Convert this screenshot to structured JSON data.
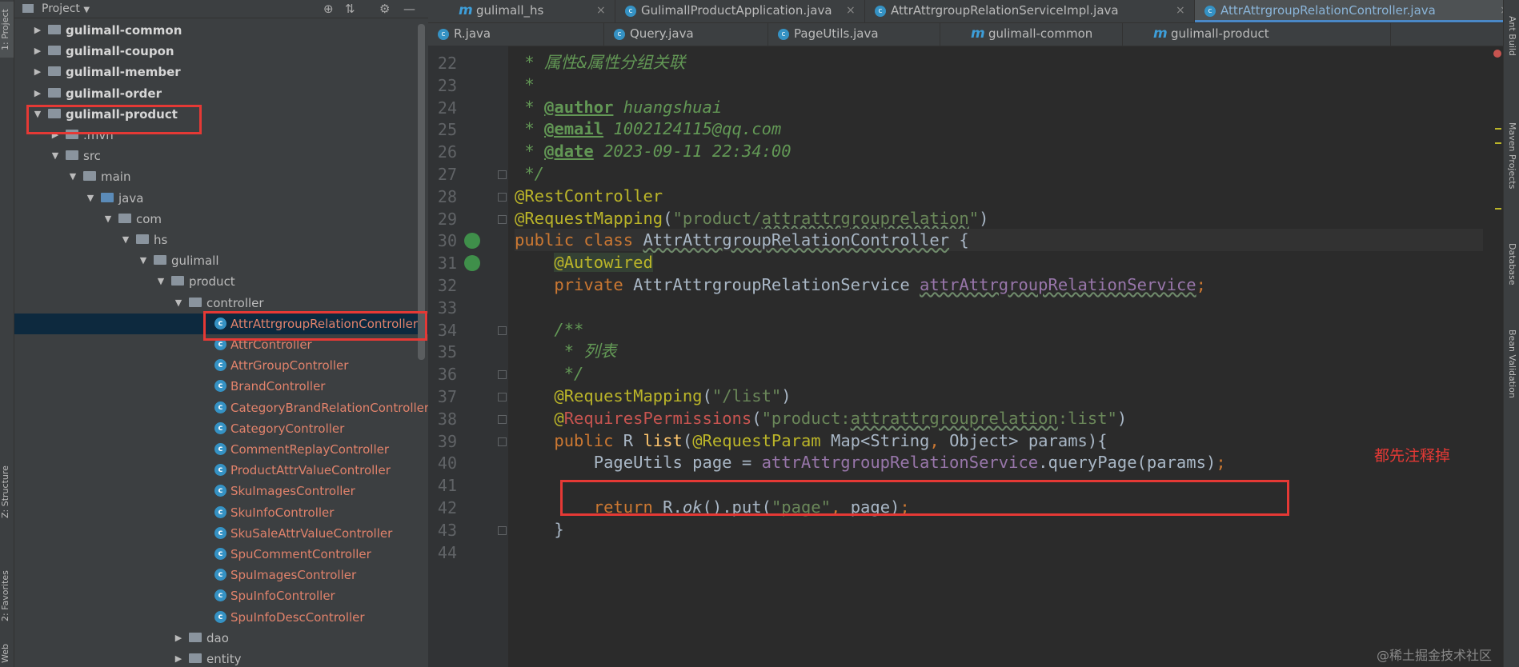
{
  "left_strip": {
    "project_tab": "1: Project",
    "structure_tab": "Z: Structure",
    "favorites_tab": "2: Favorites",
    "web_tab": "Web"
  },
  "project_panel": {
    "title": "Project",
    "dropdown_icon": "caret-down-icon",
    "icons": [
      "target-icon",
      "collapse-icon",
      "gear-icon",
      "minimize-icon"
    ]
  },
  "tree": [
    {
      "label": "gulimall-common",
      "type": "module",
      "arrow": "right",
      "bold": true
    },
    {
      "label": "gulimall-coupon",
      "type": "module",
      "arrow": "right",
      "bold": true
    },
    {
      "label": "gulimall-member",
      "type": "module",
      "arrow": "right",
      "bold": true
    },
    {
      "label": "gulimall-order",
      "type": "module",
      "arrow": "right",
      "bold": true
    },
    {
      "label": "gulimall-product",
      "type": "module",
      "arrow": "down",
      "bold": true
    },
    {
      "label": ".mvn",
      "type": "folder",
      "arrow": "right"
    },
    {
      "label": "src",
      "type": "folder",
      "arrow": "down"
    },
    {
      "label": "main",
      "type": "folder",
      "arrow": "down"
    },
    {
      "label": "java",
      "type": "folder-blue",
      "arrow": "down"
    },
    {
      "label": "com",
      "type": "package",
      "arrow": "down"
    },
    {
      "label": "hs",
      "type": "package",
      "arrow": "down"
    },
    {
      "label": "gulimall",
      "type": "package",
      "arrow": "down"
    },
    {
      "label": "product",
      "type": "package",
      "arrow": "down"
    },
    {
      "label": "controller",
      "type": "package",
      "arrow": "down"
    },
    {
      "label": "AttrAttrgroupRelationController",
      "type": "class",
      "selected": true
    },
    {
      "label": "AttrController",
      "type": "class"
    },
    {
      "label": "AttrGroupController",
      "type": "class"
    },
    {
      "label": "BrandController",
      "type": "class"
    },
    {
      "label": "CategoryBrandRelationController",
      "type": "class"
    },
    {
      "label": "CategoryController",
      "type": "class"
    },
    {
      "label": "CommentReplayController",
      "type": "class"
    },
    {
      "label": "ProductAttrValueController",
      "type": "class"
    },
    {
      "label": "SkuImagesController",
      "type": "class"
    },
    {
      "label": "SkuInfoController",
      "type": "class"
    },
    {
      "label": "SkuSaleAttrValueController",
      "type": "class"
    },
    {
      "label": "SpuCommentController",
      "type": "class"
    },
    {
      "label": "SpuImagesController",
      "type": "class"
    },
    {
      "label": "SpuInfoController",
      "type": "class"
    },
    {
      "label": "SpuInfoDescController",
      "type": "class"
    },
    {
      "label": "dao",
      "type": "package",
      "arrow": "right"
    },
    {
      "label": "entity",
      "type": "package",
      "arrow": "right"
    }
  ],
  "tabs_row1": [
    {
      "label": "gulimall_hs",
      "icon": "m"
    },
    {
      "label": "GulimallProductApplication.java",
      "icon": "c"
    },
    {
      "label": "AttrAttrgroupRelationServiceImpl.java",
      "icon": "c"
    },
    {
      "label": "AttrAttrgroupRelationController.java",
      "icon": "c",
      "active": true
    }
  ],
  "tabs_row2": [
    {
      "label": "R.java",
      "icon": "c"
    },
    {
      "label": "Query.java",
      "icon": "c"
    },
    {
      "label": "PageUtils.java",
      "icon": "c"
    },
    {
      "label": "gulimall-common",
      "icon": "m"
    },
    {
      "label": "gulimall-product",
      "icon": "m"
    }
  ],
  "code_lines": [
    {
      "n": "22",
      "html": "<span class=\"cm\"> * 属性&amp;属性分组关联</span>"
    },
    {
      "n": "23",
      "html": "<span class=\"cm\"> *</span>"
    },
    {
      "n": "24",
      "html": "<span class=\"cm\"> * </span><span class=\"tg\">@author</span><span class=\"cm\"> huangshuai</span>"
    },
    {
      "n": "25",
      "html": "<span class=\"cm\"> * </span><span class=\"tg\">@email</span><span class=\"cm\"> 1002124115@qq.com</span>"
    },
    {
      "n": "26",
      "html": "<span class=\"cm\"> * </span><span class=\"tg\">@date</span><span class=\"cm\"> 2023-09-11 22:34:00</span>"
    },
    {
      "n": "27",
      "html": "<span class=\"cm\"> */</span>"
    },
    {
      "n": "28",
      "html": "<span class=\"an\">@RestController</span>"
    },
    {
      "n": "29",
      "html": "<span class=\"an\">@RequestMapping</span>(<span class=\"st\">\"product/<span class=\"squig\">attrattrgrouprelation</span>\"</span>)"
    },
    {
      "n": "30",
      "html": "<span class=\"kw\">public class </span><span class=\"cls\"><span class=\"squig\">AttrAttrgroupRelationController</span> {</span>",
      "current": true
    },
    {
      "n": "31",
      "html": "    <span class=\"an\" style=\"background:#344134\">@Autowired</span>"
    },
    {
      "n": "32",
      "html": "    <span class=\"kw\">private </span>AttrAttrgroupRelationService <span class=\"fd\"><span class=\"squig\">attrAttrgroupRelationService</span></span><span class=\"kw\">;</span>"
    },
    {
      "n": "33",
      "html": ""
    },
    {
      "n": "34",
      "html": "    <span class=\"cm\">/**</span>"
    },
    {
      "n": "35",
      "html": "    <span class=\"cm\"> * 列表</span>"
    },
    {
      "n": "36",
      "html": "    <span class=\"cm\"> */</span>"
    },
    {
      "n": "37",
      "html": "    <span class=\"an\">@RequestMapping</span>(<span class=\"st\">\"/list\"</span>)"
    },
    {
      "n": "38",
      "html": "    <span class=\"an\">@</span><span class=\"dim\" style=\"color:#c75450\">RequiresPermissions</span>(<span class=\"st\">\"product:<span class=\"squig\">attrattrgrouprelation</span>:list\"</span>)"
    },
    {
      "n": "39",
      "html": "    <span class=\"kw\">public </span>R <span class=\"mt\">list</span>(<span class=\"an\">@RequestParam</span> Map&lt;String<span class=\"kw\">, </span>Object&gt; params){"
    },
    {
      "n": "40",
      "html": "        PageUtils page = <span class=\"fd\">attrAttrgroupRelationService</span>.queryPage(params)<span class=\"kw\">;</span>"
    },
    {
      "n": "41",
      "html": ""
    },
    {
      "n": "42",
      "html": "        <span class=\"kw\">return </span>R.<i>ok</i>().put(<span class=\"st\">\"page\"</span><span class=\"kw\">, </span>page)<span class=\"kw\">;</span>"
    },
    {
      "n": "43",
      "html": "    }"
    },
    {
      "n": "44",
      "html": ""
    }
  ],
  "annotation_note": "都先注释掉",
  "right_strip": [
    "Ant Build",
    "Maven Projects",
    "Database",
    "Bean Validation"
  ],
  "watermark": "@稀土掘金技术社区",
  "colors": {
    "highlight_red": "#e53935",
    "selection": "#0d293e",
    "tab_accent": "#4a88c7"
  }
}
